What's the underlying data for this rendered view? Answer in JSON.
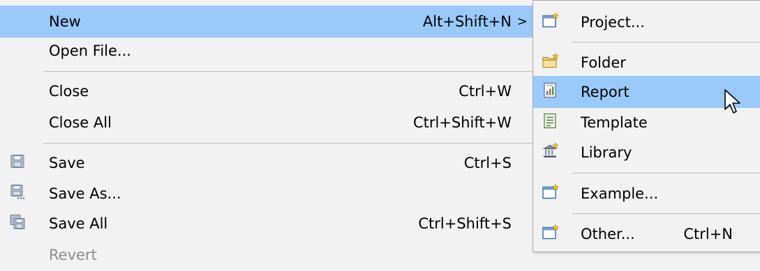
{
  "file_menu": {
    "items": [
      {
        "label": "New",
        "shortcut": "Alt+Shift+N",
        "arrow": ">"
      },
      {
        "label": "Open File..."
      },
      {
        "label": "Close",
        "shortcut": "Ctrl+W"
      },
      {
        "label": "Close All",
        "shortcut": "Ctrl+Shift+W"
      },
      {
        "label": "Save",
        "shortcut": "Ctrl+S",
        "icon": "save-icon"
      },
      {
        "label": "Save As...",
        "icon": "save-as-icon"
      },
      {
        "label": "Save All",
        "shortcut": "Ctrl+Shift+S",
        "icon": "save-all-icon"
      },
      {
        "label": "Revert",
        "disabled": true
      }
    ]
  },
  "new_submenu": {
    "items": [
      {
        "label": "Project...",
        "icon": "new-project-icon"
      },
      {
        "label": "Folder",
        "icon": "new-folder-icon"
      },
      {
        "label": "Report",
        "icon": "report-icon"
      },
      {
        "label": "Template",
        "icon": "template-icon"
      },
      {
        "label": "Library",
        "icon": "library-icon"
      },
      {
        "label": "Example...",
        "icon": "new-example-icon"
      },
      {
        "label": "Other...",
        "shortcut": "Ctrl+N",
        "icon": "new-other-icon"
      }
    ]
  },
  "colors": {
    "menu_background": "#f2f2f2",
    "highlight": "#99c9f8",
    "separator": "#bdbdbd",
    "disabled_text": "#8d8d8d"
  }
}
